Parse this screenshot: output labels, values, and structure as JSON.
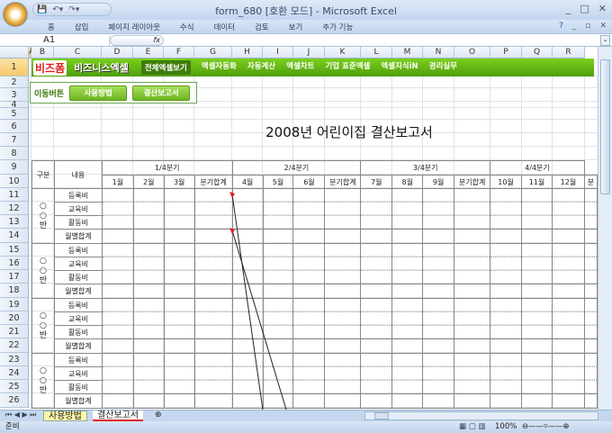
{
  "window": {
    "title": "form_680  [호환 모드] - Microsoft Excel",
    "controls": [
      "_",
      "□",
      "✕"
    ],
    "ribbon_controls": [
      "?",
      "_",
      "▫",
      "✕"
    ]
  },
  "ribbon": {
    "tabs": [
      "홈",
      "삽입",
      "페이지 레이아웃",
      "수식",
      "데이터",
      "검토",
      "보기",
      "추가 기능"
    ]
  },
  "formula_bar": {
    "name_box": "A1",
    "fx": "fx",
    "value": ""
  },
  "columns": [
    "A",
    "B",
    "C",
    "D",
    "E",
    "F",
    "G",
    "H",
    "I",
    "J",
    "K",
    "L",
    "M",
    "N",
    "O",
    "P",
    "Q",
    "R"
  ],
  "rows": [
    "1",
    "2",
    "3",
    "4",
    "5",
    "6",
    "7",
    "8",
    "9",
    "10",
    "11",
    "12",
    "13",
    "14",
    "15",
    "16",
    "17",
    "18",
    "19",
    "20",
    "21",
    "22",
    "23",
    "24",
    "25",
    "26"
  ],
  "banner": {
    "logo": "비즈폼",
    "logo2": "비즈니스엑셀",
    "nav": [
      "전체엑셀보기",
      "엑셀자동화",
      "자동계산",
      "엑셀차트",
      "기업 표준엑셀",
      "엑셀지식iN",
      "경리실무"
    ]
  },
  "move": {
    "label": "이동버튼",
    "buttons": [
      "사용방법",
      "결산보고서"
    ]
  },
  "report": {
    "title": "2008년 어린이집 결산보고서",
    "col_group": "구분",
    "col_content": "내용",
    "quarters": [
      "1/4분기",
      "2/4분기",
      "3/4분기",
      "4/4분기"
    ],
    "months": [
      "1월",
      "2월",
      "3월",
      "분기합계",
      "4월",
      "5월",
      "6월",
      "분기합계",
      "7월",
      "8월",
      "9월",
      "분기합계",
      "10월",
      "11월",
      "12월",
      "분"
    ],
    "groups": [
      {
        "name": "○○반"
      },
      {
        "name": "○○반"
      },
      {
        "name": "○○반"
      },
      {
        "name": "○○반"
      }
    ],
    "items": [
      "등록비",
      "교육비",
      "활동비",
      "월별합계"
    ]
  },
  "sheet_tabs": [
    "사용방법",
    "결산보고서"
  ],
  "status": {
    "ready": "준비",
    "zoom": "100%"
  },
  "colors": {
    "banner": "#5fb414",
    "accent_red": "#e0201a"
  }
}
